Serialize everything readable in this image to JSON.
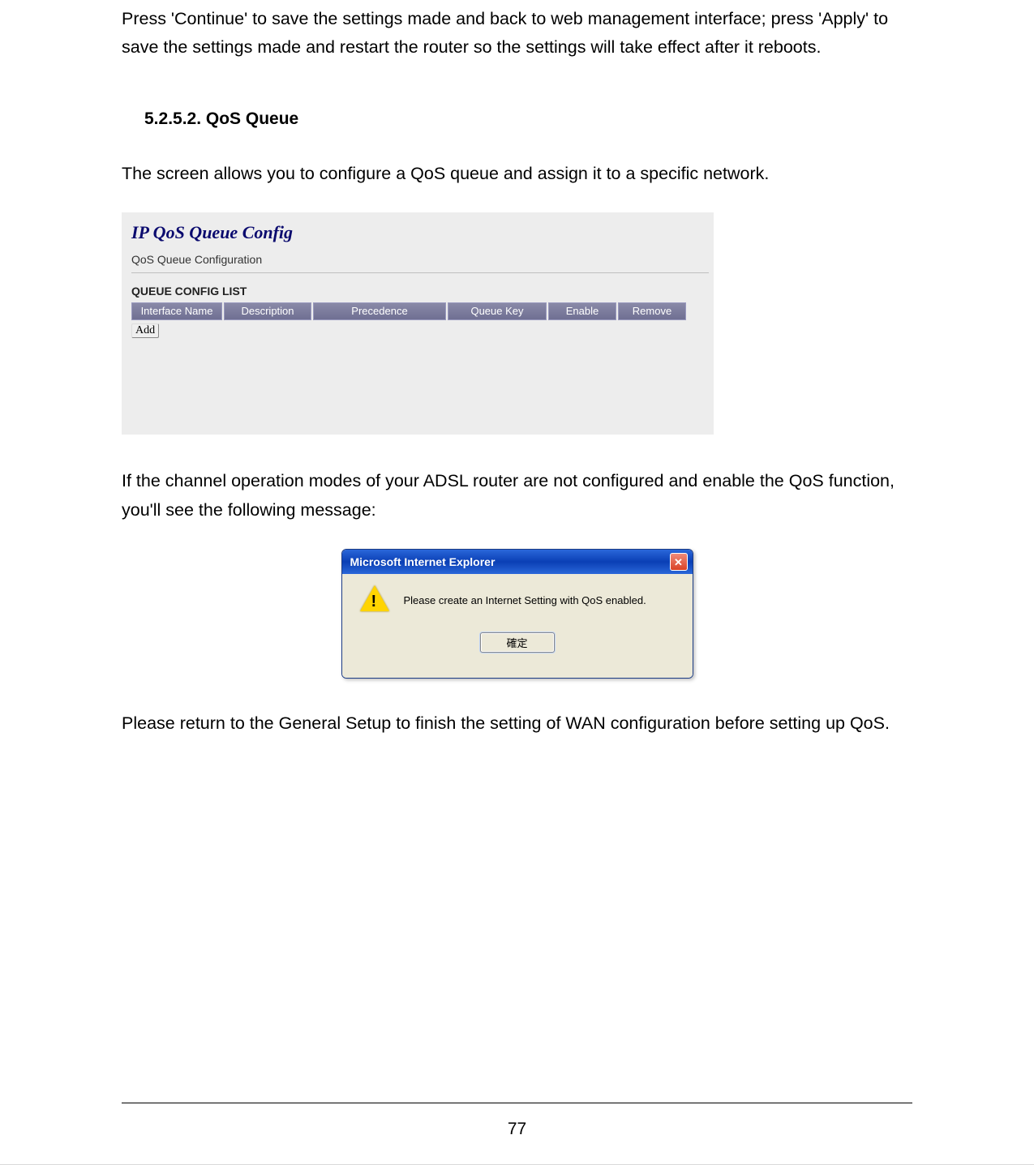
{
  "paragraphs": {
    "intro": "Press 'Continue' to save the settings made and back to web management interface; press 'Apply' to save the settings made and restart the router so the settings will take effect after it reboots.",
    "section_heading": "5.2.5.2. QoS Queue",
    "section_intro": "The screen allows you to configure a QoS queue and assign it to a specific network.",
    "post_panel": "If the channel operation modes of your ADSL router are not configured and enable the QoS function, you'll see the following message:",
    "post_dialog": "Please return to the General Setup to finish the setting of WAN configuration before setting up QoS."
  },
  "qos_panel": {
    "title": "IP QoS Queue Config",
    "subtitle": "QoS Queue Configuration",
    "list_label": "QUEUE CONFIG LIST",
    "columns": {
      "iface": "Interface Name",
      "desc": "Description",
      "prec": "Precedence",
      "qkey": "Queue Key",
      "enable": "Enable",
      "remove": "Remove"
    },
    "add_button": "Add"
  },
  "dialog": {
    "title": "Microsoft Internet Explorer",
    "message": "Please create an Internet Setting with QoS enabled.",
    "ok_button": "確定"
  },
  "page_number": "77"
}
